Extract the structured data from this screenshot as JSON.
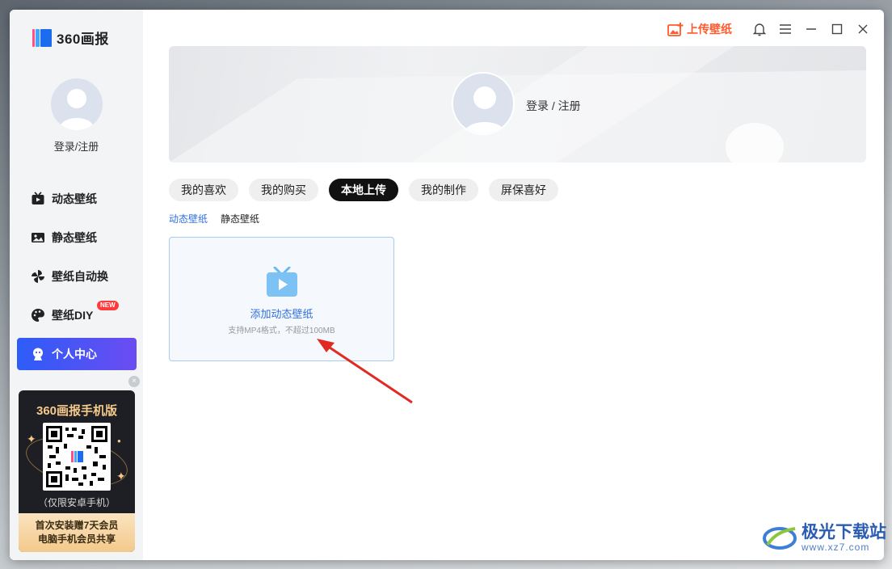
{
  "app": {
    "logo_text": "360画报",
    "brand_colors": [
      "#ff4f8a",
      "#3fa7ff",
      "#1d6cf0"
    ]
  },
  "sidebar": {
    "login_label": "登录/注册",
    "items": [
      {
        "label": "动态壁纸",
        "icon": "tv-play-icon"
      },
      {
        "label": "静态壁纸",
        "icon": "image-icon"
      },
      {
        "label": "壁纸自动换",
        "icon": "pinwheel-icon"
      },
      {
        "label": "壁纸DIY",
        "icon": "palette-icon",
        "badge": "NEW"
      },
      {
        "label": "个人中心",
        "icon": "user-center-icon",
        "active": true
      }
    ],
    "promo": {
      "title": "360画报手机版",
      "note": "（仅限安卓手机）",
      "foot_line1": "首次安装赠7天会员",
      "foot_line2": "电脑手机会员共享",
      "close_glyph": "×"
    }
  },
  "topbar": {
    "upload_label": "上传壁纸",
    "accent_color": "#ff5a2b"
  },
  "banner": {
    "login_label": "登录 / 注册"
  },
  "tabs": [
    {
      "label": "我的喜欢"
    },
    {
      "label": "我的购买"
    },
    {
      "label": "本地上传",
      "active": true
    },
    {
      "label": "我的制作"
    },
    {
      "label": "屏保喜好"
    }
  ],
  "subtabs": [
    {
      "label": "动态壁纸",
      "active": true
    },
    {
      "label": "静态壁纸"
    }
  ],
  "upload_card": {
    "title": "添加动态壁纸",
    "hint": "支持MP4格式，不超过100MB",
    "accent_color": "#2f6fe0"
  },
  "watermark": {
    "title": "极光下载站",
    "url": "www.xz7.com"
  }
}
